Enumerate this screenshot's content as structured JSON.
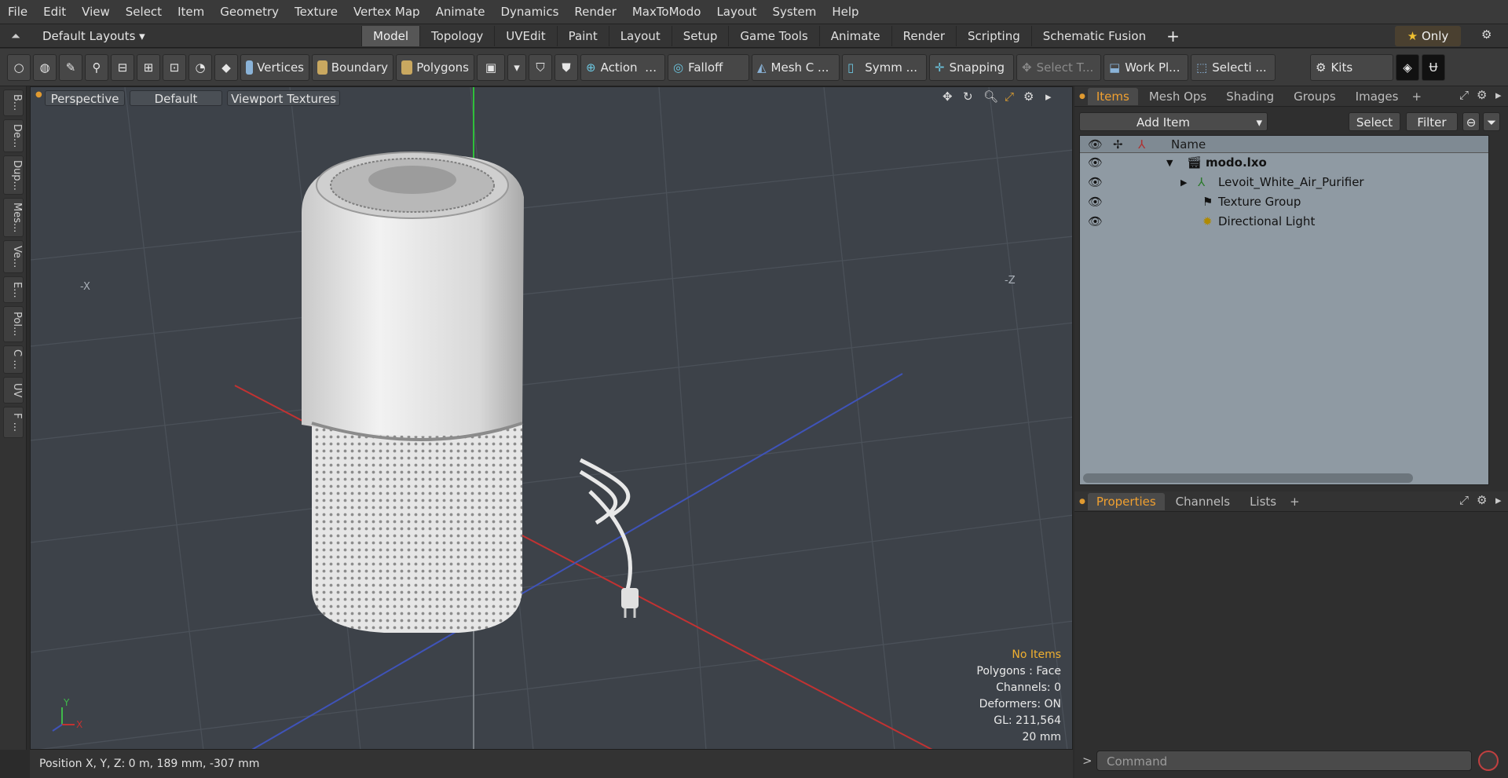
{
  "menubar": {
    "items": [
      "File",
      "Edit",
      "View",
      "Select",
      "Item",
      "Geometry",
      "Texture",
      "Vertex Map",
      "Animate",
      "Dynamics",
      "Render",
      "MaxToModo",
      "Layout",
      "System",
      "Help"
    ]
  },
  "layoutbar": {
    "layout_selector": "Default Layouts",
    "tabs": [
      "Model",
      "Topology",
      "UVEdit",
      "Paint",
      "Layout",
      "Setup",
      "Game Tools",
      "Animate",
      "Render",
      "Scripting",
      "Schematic Fusion"
    ],
    "active_tab": "Model",
    "only_label": "Only"
  },
  "toolbar": {
    "vertices": "Vertices",
    "boundary": "Boundary",
    "polygons": "Polygons",
    "action": "Action",
    "falloff": "Falloff",
    "mesh": "Mesh C ...",
    "symmetry": "Symm ...",
    "snapping": "Snapping",
    "select_t": "Select T...",
    "work_plane": "Work Pl...",
    "selection": "Selecti ...",
    "kits": "Kits"
  },
  "left_tabs": [
    "B...",
    "De...",
    "Dup...",
    "Mes...",
    "Ve...",
    "E...",
    "Pol...",
    "C ...",
    "UV",
    "F ..."
  ],
  "viewport": {
    "view": "Perspective",
    "shading": "Default",
    "textures": "Viewport Textures",
    "axis_x_label": "-X",
    "axis_z_label": "-Z",
    "gizmo_y": "Y",
    "gizmo_x": "X",
    "info": {
      "selection": "No Items",
      "polygons": "Polygons : Face",
      "channels": "Channels: 0",
      "deformers": "Deformers: ON",
      "gl": "GL: 211,564",
      "scale": "20 mm"
    }
  },
  "statusbar": {
    "position": "Position X, Y, Z:   0 m, 189 mm, -307 mm"
  },
  "items_panel": {
    "tabs": [
      "Items",
      "Mesh Ops",
      "Shading",
      "Groups",
      "Images"
    ],
    "active_tab": "Items",
    "add_item": "Add Item",
    "select": "Select",
    "filter": "Filter",
    "name_header": "Name",
    "rows": [
      {
        "label": "modo.lxo"
      },
      {
        "label": "Levoit_White_Air_Purifier"
      },
      {
        "label": "Texture Group"
      },
      {
        "label": "Directional Light"
      }
    ]
  },
  "properties_panel": {
    "tabs": [
      "Properties",
      "Channels",
      "Lists"
    ],
    "active_tab": "Properties"
  },
  "command": {
    "placeholder": "Command"
  },
  "colors": {
    "accent": "#f0a030",
    "viewport_bg": "#3d4249",
    "items_bg": "#8f9aa3"
  }
}
